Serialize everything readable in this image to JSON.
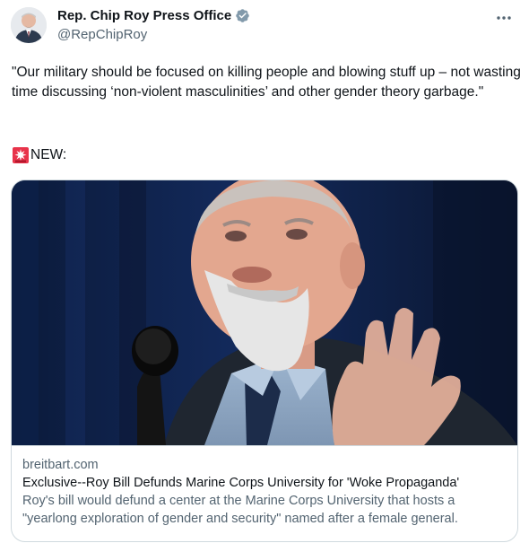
{
  "author": {
    "display_name": "Rep. Chip Roy Press Office",
    "handle": "@RepChipRoy",
    "verified_icon": "verified-badge-icon",
    "verified_color": "#536471"
  },
  "tweet": {
    "text": "\"Our military should be focused on killing people and blowing stuff up – not wasting time discussing ‘non-violent masculinities’ and other gender theory garbage.\"",
    "new_label": "NEW:",
    "siren_icon": "rotating-light-icon"
  },
  "card": {
    "domain": "breitbart.com",
    "title": "Exclusive--Roy Bill Defunds Marine Corps University for 'Woke Propaganda'",
    "description": "Roy's bill would defund a center at the Marine Corps University that hosts a \"yearlong exploration of gender and security\" named after a female general."
  },
  "colors": {
    "text_primary": "#0f1419",
    "text_secondary": "#536471",
    "border": "#cfd9de"
  }
}
